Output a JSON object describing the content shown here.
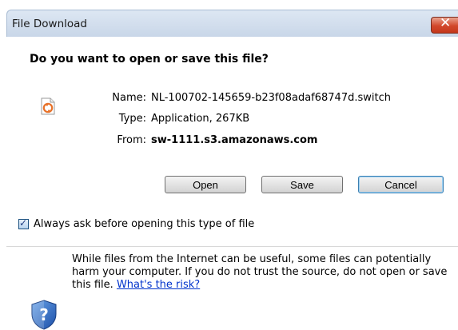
{
  "window": {
    "title": "File Download"
  },
  "title_bar": {
    "close_symbol": "✕"
  },
  "dialog": {
    "question": "Do you want to open or save this file?",
    "file_icon": "switch-file-icon",
    "fields": {
      "name_label": "Name:",
      "name_value": "NL-100702-145659-b23f08adaf68747d.switch",
      "type_label": "Type:",
      "type_value": "Application, 267KB",
      "from_label": "From:",
      "from_value": "sw-1111.s3.amazonaws.com"
    },
    "buttons": {
      "open": "Open",
      "save": "Save",
      "cancel": "Cancel",
      "default": "Cancel"
    },
    "checkbox": {
      "label": "Always ask before opening this type of file",
      "checked": true
    },
    "warning": {
      "icon": "shield-question-icon",
      "text": "While files from the Internet can be useful, some files can potentially harm your computer. If you do not trust the source, do not open or save this file.",
      "link": "What's the risk?"
    }
  }
}
